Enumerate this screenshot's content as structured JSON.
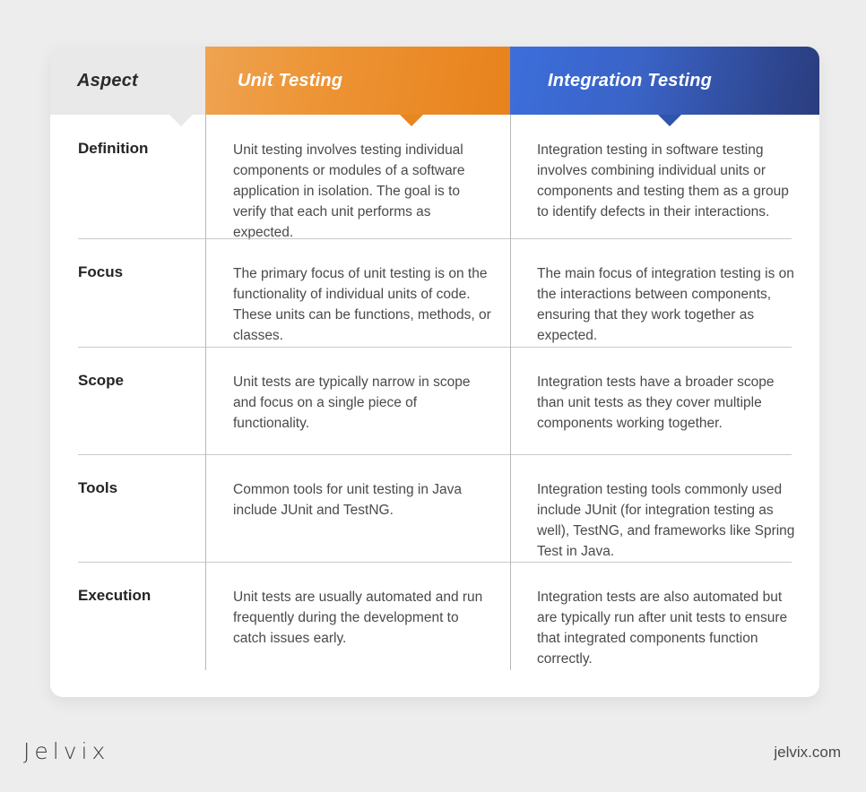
{
  "card": {
    "headers": [
      {
        "label": "Aspect",
        "kind": "aspect"
      },
      {
        "label": "Unit Testing",
        "kind": "unit",
        "color": "#e8821c"
      },
      {
        "label": "Integration Testing",
        "kind": "integration",
        "color": "#2a3c7d"
      }
    ],
    "rows": [
      {
        "aspect": "Definition",
        "unit": "Unit testing involves testing individual components or modules of a software application in isolation. The goal is to verify that each unit performs as expected.",
        "integration": "Integration testing in software testing involves combining individual units or components and testing them as a group to identify defects in their interactions."
      },
      {
        "aspect": "Focus",
        "unit": "The primary focus of unit testing is on the functionality of individual units of code. These units can be functions, methods, or classes.",
        "integration": "The main focus of integration testing is on the interactions between components, ensuring that they work together as expected."
      },
      {
        "aspect": "Scope",
        "unit": "Unit tests are typically narrow in scope and focus on a single piece of functionality.",
        "integration": "Integration tests have a broader scope than unit tests as they cover multiple components working together."
      },
      {
        "aspect": "Tools",
        "unit": "Common tools for unit testing in Java include JUnit and TestNG.",
        "integration": "Integration testing tools commonly used include JUnit (for integration testing as well), TestNG, and frameworks like Spring Test in Java."
      },
      {
        "aspect": "Execution",
        "unit": "Unit tests are usually automated and run frequently during the development to catch issues early.",
        "integration": "Integration tests are also automated but are typically run after unit tests to ensure that integrated components function correctly."
      }
    ]
  },
  "footer": {
    "logo": "Jelvix",
    "site": "jelvix.com"
  },
  "theme": {
    "page_background": "#ededed",
    "card_background": "#ffffff",
    "aspect_header_background": "#e9e9e9",
    "orange_start": "#efa351",
    "orange_end": "#e8821c",
    "blue_start": "#3c6edb",
    "blue_end": "#2a3c7d",
    "divider": "#c9c9c9",
    "body_text": "#4a4a4a",
    "heading_text": "#242424"
  }
}
